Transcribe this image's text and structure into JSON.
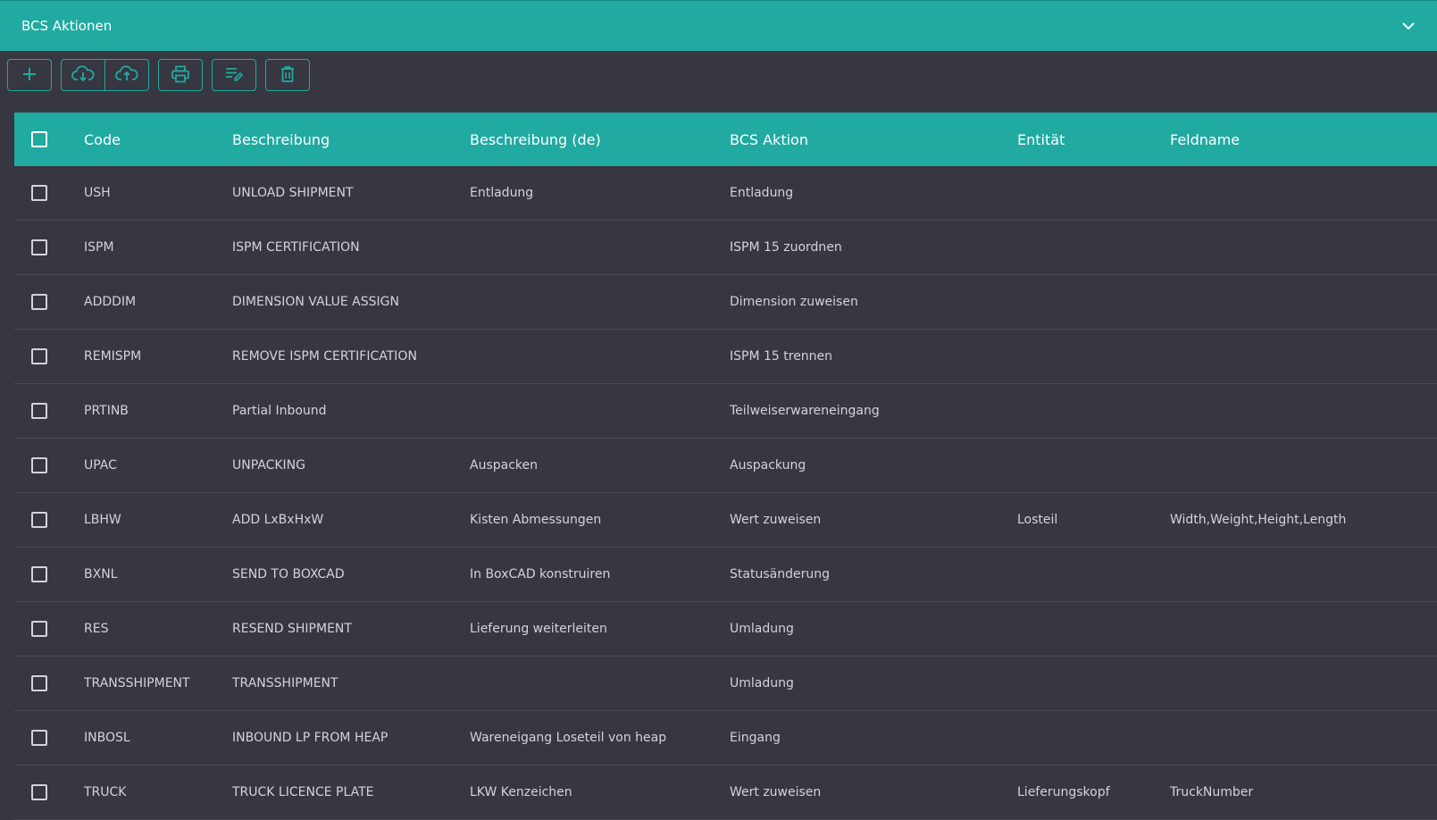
{
  "header": {
    "title": "BCS Aktionen"
  },
  "icons": {
    "expand": "chevron-down-icon",
    "add": "plus-icon",
    "download": "cloud-download-icon",
    "upload": "cloud-upload-icon",
    "print": "printer-icon",
    "edit": "edit-list-icon",
    "delete": "trash-icon"
  },
  "colors": {
    "accent": "#20aaa1",
    "background": "#363740",
    "text": "#d3d4d8"
  },
  "table": {
    "columns": [
      "Code",
      "Beschreibung",
      "Beschreibung (de)",
      "BCS Aktion",
      "Entität",
      "Feldname"
    ],
    "rows": [
      [
        "USH",
        "UNLOAD SHIPMENT",
        "Entladung",
        "Entladung",
        "",
        ""
      ],
      [
        "ISPM",
        "ISPM CERTIFICATION",
        "",
        "ISPM 15 zuordnen",
        "",
        ""
      ],
      [
        "ADDDIM",
        "DIMENSION VALUE ASSIGN",
        "",
        "Dimension zuweisen",
        "",
        ""
      ],
      [
        "REMISPM",
        "REMOVE ISPM CERTIFICATION",
        "",
        "ISPM 15 trennen",
        "",
        ""
      ],
      [
        "PRTINB",
        "Partial Inbound",
        "",
        "Teilweiserwareneingang",
        "",
        ""
      ],
      [
        "UPAC",
        "UNPACKING",
        "Auspacken",
        "Auspackung",
        "",
        ""
      ],
      [
        "LBHW",
        "ADD LxBxHxW",
        "Kisten Abmessungen",
        "Wert zuweisen",
        "Losteil",
        "Width,Weight,Height,Length"
      ],
      [
        "BXNL",
        "SEND TO BOXCAD",
        "In BoxCAD konstruiren",
        "Statusänderung",
        "",
        ""
      ],
      [
        "RES",
        "RESEND SHIPMENT",
        "Lieferung weiterleiten",
        "Umladung",
        "",
        ""
      ],
      [
        "TRANSSHIPMENT",
        "TRANSSHIPMENT",
        "",
        "Umladung",
        "",
        ""
      ],
      [
        "INBOSL",
        "INBOUND LP FROM HEAP",
        "Wareneigang Loseteil von heap",
        "Eingang",
        "",
        ""
      ],
      [
        "TRUCK",
        "TRUCK LICENCE PLATE",
        "LKW Kenzeichen",
        "Wert zuweisen",
        "Lieferungskopf",
        "TruckNumber"
      ]
    ]
  }
}
